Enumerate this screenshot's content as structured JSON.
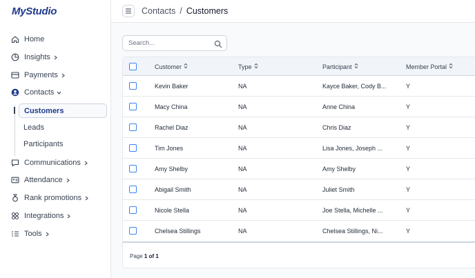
{
  "app": {
    "logo": "MyStudio"
  },
  "sidebar": {
    "items": [
      {
        "label": "Home",
        "icon": "home-icon"
      },
      {
        "label": "Insights",
        "icon": "pie-chart-icon",
        "chevron": "right"
      },
      {
        "label": "Payments",
        "icon": "credit-card-icon",
        "chevron": "right"
      },
      {
        "label": "Contacts",
        "icon": "user-circle-icon",
        "chevron": "down"
      },
      {
        "label": "Communications",
        "icon": "chat-icon",
        "chevron": "right"
      },
      {
        "label": "Attendance",
        "icon": "id-card-icon",
        "chevron": "right"
      },
      {
        "label": "Rank promotions",
        "icon": "medal-icon",
        "chevron": "right"
      },
      {
        "label": "Integrations",
        "icon": "puzzle-icon",
        "chevron": "right"
      },
      {
        "label": "Tools",
        "icon": "list-icon",
        "chevron": "right"
      }
    ],
    "contacts_sub": [
      "Customers",
      "Leads",
      "Participants"
    ]
  },
  "header": {
    "breadcrumb": [
      "Contacts",
      "Customers"
    ],
    "separator": "/"
  },
  "search": {
    "placeholder": "Search...",
    "value": ""
  },
  "table": {
    "columns": [
      "Customer",
      "Type",
      "Participant",
      "Member Portal"
    ],
    "rows": [
      {
        "customer": "Kevin Baker",
        "type": "NA",
        "participant": "Kayce Baker, Cody B...",
        "portal": "Y"
      },
      {
        "customer": "Macy China",
        "type": "NA",
        "participant": "Anne China",
        "portal": "Y"
      },
      {
        "customer": "Rachel Diaz",
        "type": "NA",
        "participant": "Chris Diaz",
        "portal": "Y"
      },
      {
        "customer": "Tim Jones",
        "type": "NA",
        "participant": "Lisa Jones, Joseph ...",
        "portal": "Y"
      },
      {
        "customer": "Amy Shelby",
        "type": "NA",
        "participant": "Amy Shelby",
        "portal": "Y"
      },
      {
        "customer": "Abigail Smith",
        "type": "NA",
        "participant": "Juliet Smith",
        "portal": "Y"
      },
      {
        "customer": "Nicole Stella",
        "type": "NA",
        "participant": "Joe Stella, Michelle ...",
        "portal": "Y"
      },
      {
        "customer": "Chelsea Stillings",
        "type": "NA",
        "participant": "Chelsea Stillings, Ni...",
        "portal": "Y"
      }
    ],
    "pager": {
      "prefix": "Page",
      "current": "1 of 1"
    }
  },
  "colors": {
    "accent": "#1e3a8a",
    "checkbox": "#3b82f6"
  }
}
